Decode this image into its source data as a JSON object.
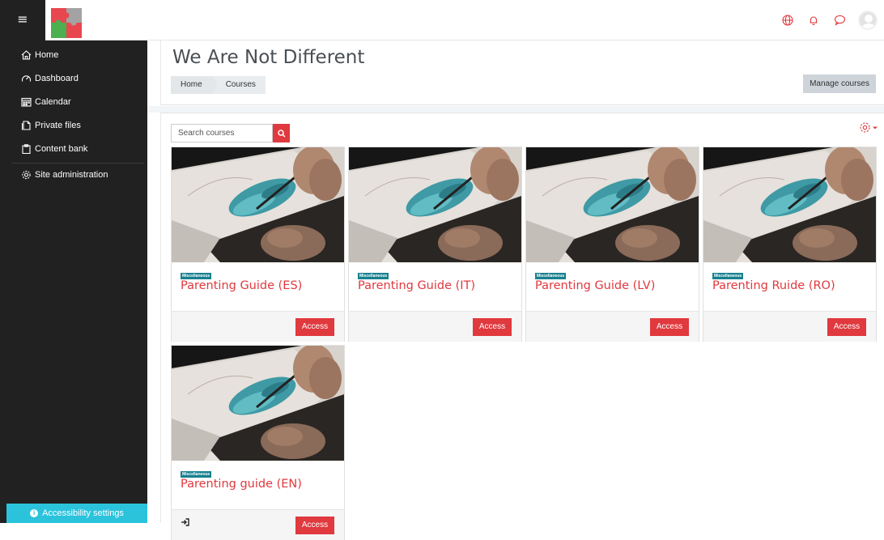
{
  "navbar": {
    "menu_icon": "hamburger-icon",
    "logo": "puzzle-logo",
    "icons": [
      "globe-icon",
      "bell-icon",
      "chat-icon",
      "user-avatar"
    ],
    "accent": "#e0393e"
  },
  "sidebar": {
    "items": [
      {
        "label": "Home",
        "icon": "home-icon"
      },
      {
        "label": "Dashboard",
        "icon": "dashboard-icon"
      },
      {
        "label": "Calendar",
        "icon": "calendar-icon"
      },
      {
        "label": "Private files",
        "icon": "files-icon"
      },
      {
        "label": "Content bank",
        "icon": "clipboard-icon"
      },
      {
        "label": "Site administration",
        "icon": "gear-icon"
      }
    ],
    "accessibility_label": "Accessibility settings",
    "accessibility_color": "#2bc3dc"
  },
  "header": {
    "title": "We Are Not Different",
    "breadcrumb": [
      "Home",
      "Courses"
    ],
    "manage_label": "Manage courses"
  },
  "main": {
    "search_placeholder": "Search courses",
    "courses": [
      {
        "category": "Miscellaneous",
        "name": "Parenting Guide (ES)",
        "button": "Access"
      },
      {
        "category": "Miscellaneous",
        "name": "Parenting Guide (IT)",
        "button": "Access"
      },
      {
        "category": "Miscellaneous",
        "name": "Parenting Guide (LV)",
        "button": "Access"
      },
      {
        "category": "Miscellaneous",
        "name": "Parenting Ruide (RO)",
        "button": "Access"
      },
      {
        "category": "Miscellaneous",
        "name": "Parenting guide (EN)",
        "button": "Access"
      }
    ]
  }
}
